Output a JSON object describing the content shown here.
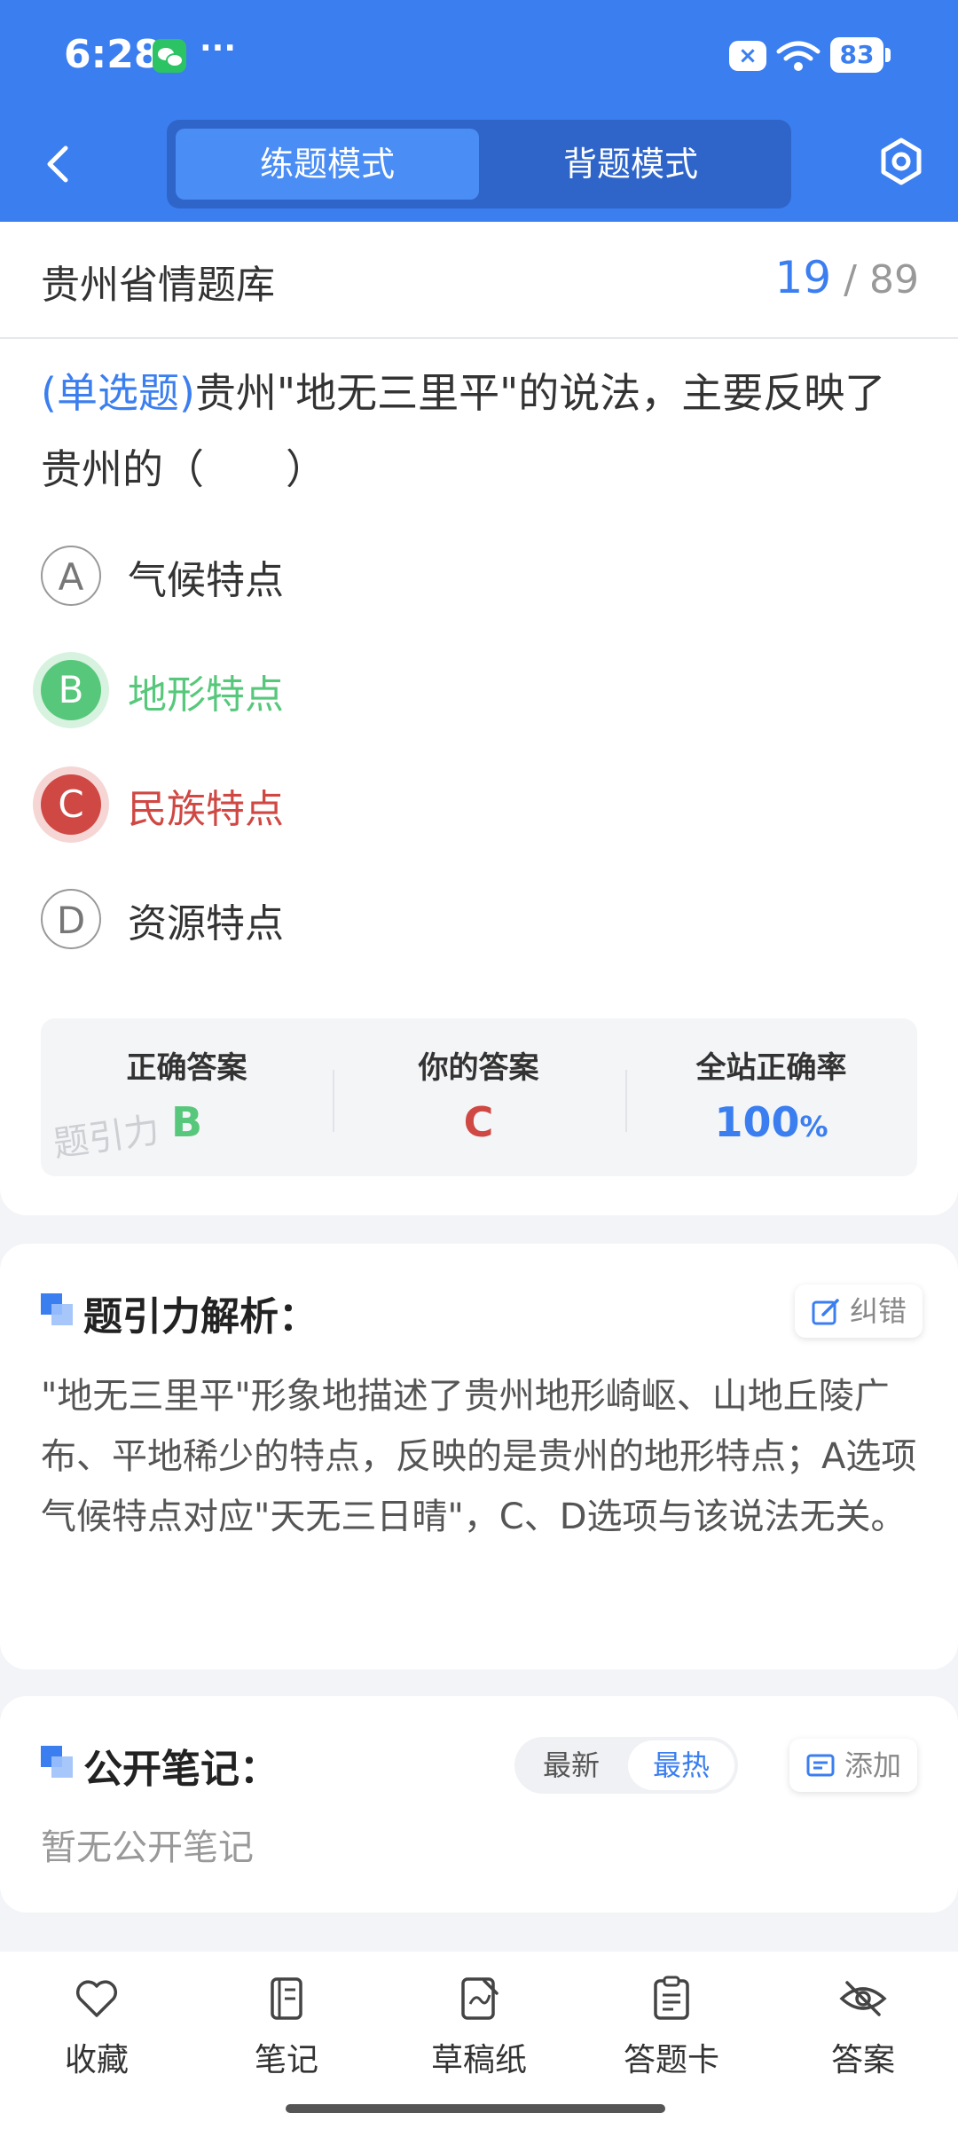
{
  "status_bar": {
    "time": "6:28",
    "dots": "···",
    "x_badge": "×",
    "battery": "83"
  },
  "header": {
    "tabs": [
      "练题模式",
      "背题模式"
    ]
  },
  "bank": {
    "title": "贵州省情题库",
    "current": "19",
    "total": "89",
    "separator": "/"
  },
  "question": {
    "type": "(单选题)",
    "text": "贵州\"地无三里平\"的说法，主要反映了贵州的（　　）"
  },
  "options": [
    {
      "key": "A",
      "text": "气候特点"
    },
    {
      "key": "B",
      "text": "地形特点"
    },
    {
      "key": "C",
      "text": "民族特点"
    },
    {
      "key": "D",
      "text": "资源特点"
    }
  ],
  "result": {
    "correct_label": "正确答案",
    "correct_value": "B",
    "yours_label": "你的答案",
    "yours_value": "C",
    "rate_label": "全站正确率",
    "rate_value": "100",
    "rate_unit": "%",
    "watermark": "题引力",
    "colors": {
      "correct": "#57c87b",
      "wrong": "#cf4843",
      "accent": "#3b7ef0"
    }
  },
  "analysis": {
    "title": "题引力解析：",
    "report_label": "纠错",
    "text": "\"地无三里平\"形象地描述了贵州地形崎岖、山地丘陵广布、平地稀少的特点，反映的是贵州的地形特点；A选项气候特点对应\"天无三日晴\"，C、D选项与该说法无关。"
  },
  "notes": {
    "title": "公开笔记：",
    "sort": [
      "最新",
      "最热"
    ],
    "add_label": "添加",
    "empty_text": "暂无公开笔记"
  },
  "tabbar": [
    "收藏",
    "笔记",
    "草稿纸",
    "答题卡",
    "答案"
  ]
}
